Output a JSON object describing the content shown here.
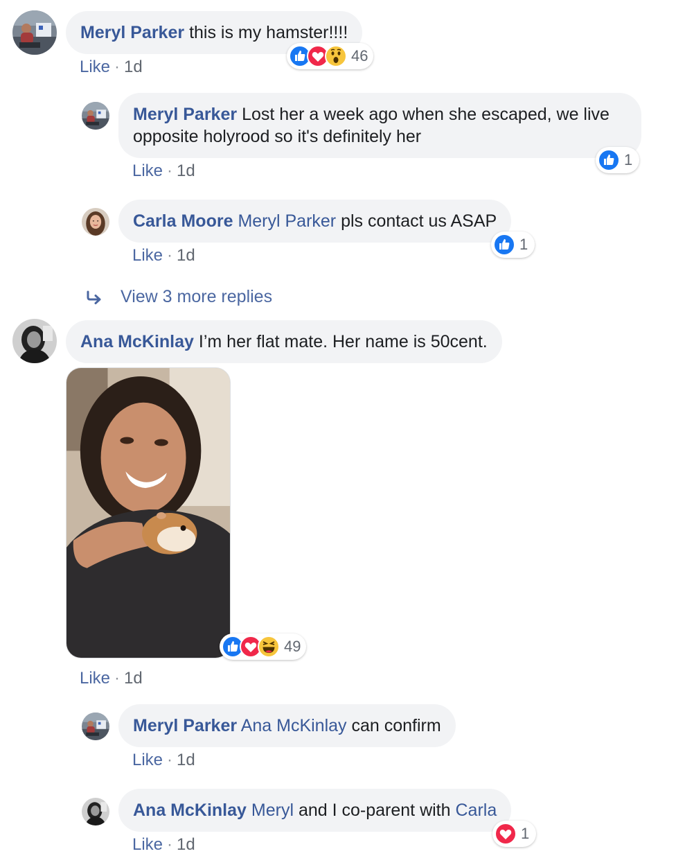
{
  "actions": {
    "like": "Like",
    "separator": "·"
  },
  "comments": [
    {
      "author": "Meryl Parker",
      "text": "this is my hamster!!!!",
      "time": "1d",
      "reactions": {
        "icons": [
          "like-icon",
          "love-icon",
          "wow-icon"
        ],
        "count": "46"
      },
      "replies": [
        {
          "author": "Meryl Parker",
          "text": "Lost her a week ago when she escaped, we live opposite holyrood so it's definitely her",
          "time": "1d",
          "reactions": {
            "icons": [
              "like-icon"
            ],
            "count": "1"
          }
        },
        {
          "author": "Carla Moore",
          "mention": "Meryl Parker",
          "text": "pls contact us ASAP",
          "time": "1d",
          "reactions": {
            "icons": [
              "like-icon"
            ],
            "count": "1"
          }
        }
      ],
      "view_more": "View 3 more replies"
    },
    {
      "author": "Ana McKinlay",
      "text": "I’m her flat mate. Her name is 50cent.",
      "time": "1d",
      "has_photo": true,
      "reactions": {
        "icons": [
          "like-icon",
          "love-icon",
          "haha-icon"
        ],
        "count": "49"
      },
      "replies": [
        {
          "author": "Meryl Parker",
          "mention": "Ana McKinlay",
          "text": "can confirm",
          "time": "1d"
        },
        {
          "author": "Ana McKinlay",
          "mention": "Meryl",
          "text": "and I co-parent with",
          "mention2": "Carla",
          "time": "1d",
          "reactions": {
            "icons": [
              "love-icon"
            ],
            "count": "1"
          }
        }
      ]
    }
  ],
  "colors": {
    "link": "#385898",
    "bubble": "#f2f3f5",
    "like": "#1877f2",
    "love": "#f0284a",
    "wow": "#f7b125"
  }
}
